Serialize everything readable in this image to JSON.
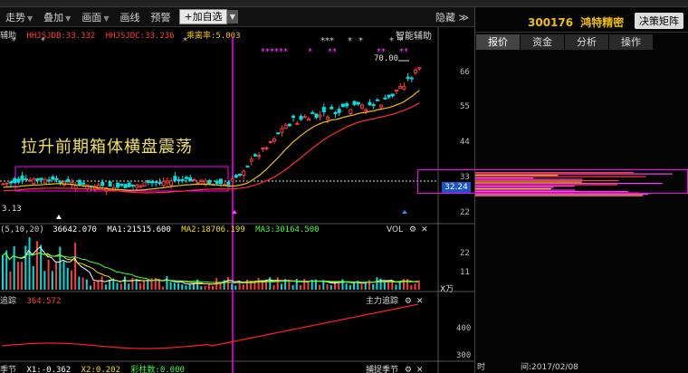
{
  "colors": {
    "up": "#ff3b3b",
    "down": "#00e0e0",
    "accent_yellow": "#f0c000",
    "magenta": "#ff00ff",
    "ma5": "#ffffff",
    "ma10": "#f0e000",
    "ma20": "#ff00ff"
  },
  "toolbar": {
    "items": [
      {
        "label": "走势",
        "has_caret": true
      },
      {
        "label": "叠加",
        "has_caret": true
      },
      {
        "label": "画面",
        "has_caret": true
      },
      {
        "label": "画线",
        "has_caret": false
      },
      {
        "label": "预警",
        "has_caret": false
      }
    ],
    "add_button": "+加自选",
    "hide_label": "隐藏 ≫"
  },
  "indicator_top": {
    "label": "辅助",
    "hhjsjdb": "HHJSJDB:33.332",
    "hhjsjdc": "HHJSJDC:33.236",
    "rate": "乘离率:5.003",
    "smart_assist": "智能辅助"
  },
  "annotation": {
    "text": "拉升前期箱体横盘震荡",
    "box_note": ""
  },
  "price_chart": {
    "y_labels": [
      "66",
      "55",
      "44",
      "33",
      "22"
    ],
    "high_label": "70.00",
    "low_label": "3.13",
    "current_price": "32.24"
  },
  "volume_panel": {
    "label": "(5,10,20)",
    "vol": "36642.070",
    "ma1": "MA1:21515.600",
    "ma2": "MA2:18706.199",
    "ma3": "MA3:30164.500",
    "title": "VOL",
    "y_labels": [
      "22",
      "11"
    ],
    "unit": "X万"
  },
  "trace_panel": {
    "label": "追踪",
    "value": "364.572",
    "title": "主力追踪",
    "y_labels": [
      "400",
      "300"
    ]
  },
  "bottom_panel": {
    "label": "季节",
    "x1": "X1:-0.362",
    "x2": "X2:0.202",
    "rainbow": "彩柱数:0.000",
    "title": "捕捉季节"
  },
  "right_panel": {
    "code": "300176",
    "name": "鸿特精密",
    "decision_btn": "决策矩阵",
    "tabs": [
      "报价",
      "资金",
      "分析",
      "操作"
    ],
    "time_label": "时",
    "date_label": "间:2017/02/08"
  }
}
